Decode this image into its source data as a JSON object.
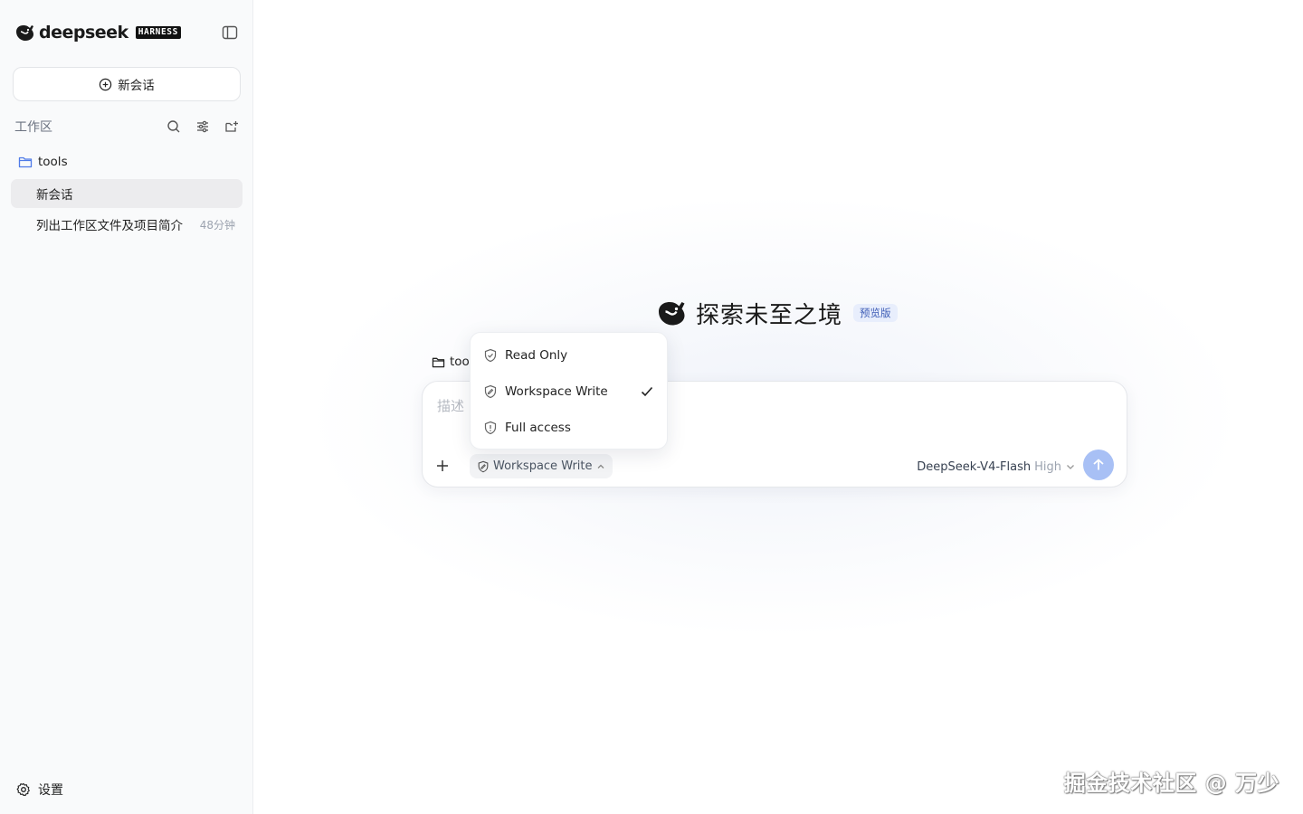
{
  "sidebar": {
    "brand": {
      "name": "deepseek",
      "tag": "HARNESS"
    },
    "new_chat_label": "新会话",
    "workspace_label": "工作区",
    "folder": {
      "name": "tools"
    },
    "conversations": [
      {
        "title": "新会话",
        "time": "",
        "active": true
      },
      {
        "title": "列出工作区文件及项目简介",
        "time": "48分钟",
        "active": false
      }
    ],
    "settings_label": "设置"
  },
  "main": {
    "hero_title": "探索未至之境",
    "hero_badge": "预览版",
    "folder_chip": "too",
    "composer": {
      "placeholder": "描述",
      "mode_label": "Workspace Write",
      "model_name": "DeepSeek-V4-Flash",
      "model_level": "High"
    },
    "permission_menu": {
      "items": [
        {
          "label": "Read Only",
          "icon": "shield-check-icon",
          "selected": false
        },
        {
          "label": "Workspace Write",
          "icon": "shield-edit-icon",
          "selected": true
        },
        {
          "label": "Full access",
          "icon": "shield-alert-icon",
          "selected": false
        }
      ]
    }
  },
  "watermark": "掘金技术社区 @ 万少",
  "colors": {
    "accent": "#a8c0f5",
    "badge_bg": "#e8eefc",
    "badge_text": "#3b5bb5",
    "folder_icon": "#4f7be8"
  }
}
